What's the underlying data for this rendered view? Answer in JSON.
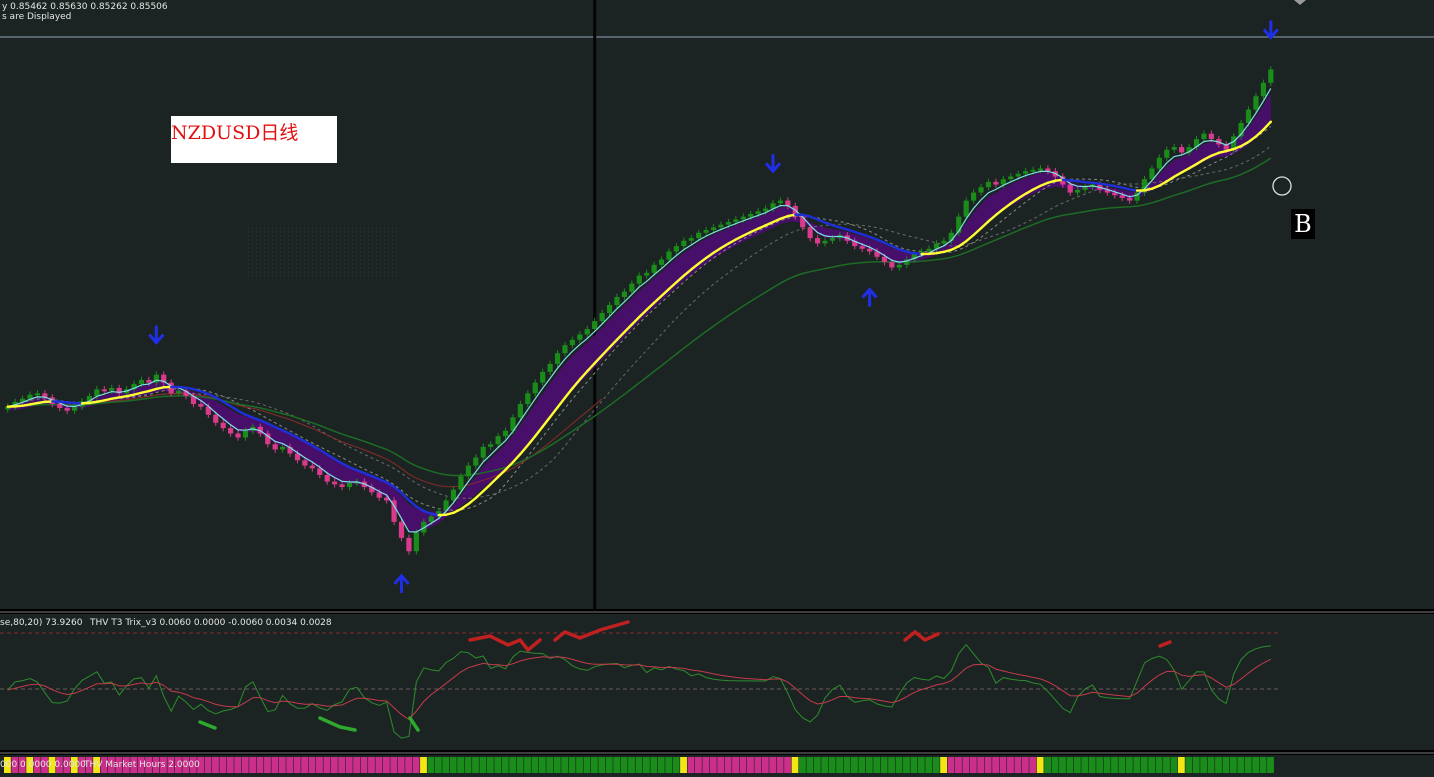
{
  "header": {
    "price_line": "y  0.85462 0.85630 0.85262 0.85506",
    "info_line": "s are Displayed"
  },
  "chart_label": "NZDUSD日线",
  "signal_label": "B",
  "subpanel1": {
    "label_left": "se,80,20) 73.9260",
    "label_right": "THV T3 Trix_v3   0.0060 0.0000 -0.0060 0.0034 0.0028"
  },
  "subpanel2": {
    "label_left": "000  0.0000 0.0000",
    "label_right": "THV Market Hours 2.0000"
  },
  "colors": {
    "background": "#1b2422",
    "bull": "#1a8c1a",
    "bear": "#d93a8c",
    "t3_fast": "#7fe0e6",
    "t3_up": "#ffff33",
    "t3_down": "#1f2fd8",
    "cloud": "#4a0f6e",
    "slow_ma": "#1e6b26",
    "trix_main": "#c63a4d",
    "trix_sig": "#2e8c2e",
    "arrow": "#1f2fe8",
    "hours_pink": "#cc2e8c",
    "hours_green": "#1a8c1a",
    "hours_yellow": "#f2e614"
  },
  "chart_data": {
    "type": "candlestick",
    "closes": [
      0.699,
      0.7008,
      0.702,
      0.7035,
      0.704,
      0.7025,
      0.7,
      0.6985,
      0.6975,
      0.699,
      0.701,
      0.703,
      0.7055,
      0.705,
      0.706,
      0.704,
      0.7055,
      0.7075,
      0.709,
      0.708,
      0.711,
      0.708,
      0.704,
      0.705,
      0.703,
      0.7,
      0.699,
      0.696,
      0.693,
      0.691,
      0.689,
      0.6875,
      0.69,
      0.6915,
      0.689,
      0.685,
      0.683,
      0.684,
      0.6815,
      0.679,
      0.677,
      0.676,
      0.6735,
      0.671,
      0.67,
      0.669,
      0.6705,
      0.671,
      0.669,
      0.667,
      0.665,
      0.664,
      0.656,
      0.65,
      0.645,
      0.652,
      0.656,
      0.658,
      0.66,
      0.664,
      0.668,
      0.673,
      0.677,
      0.68,
      0.684,
      0.685,
      0.688,
      0.69,
      0.695,
      0.7,
      0.704,
      0.708,
      0.712,
      0.715,
      0.719,
      0.722,
      0.724,
      0.726,
      0.728,
      0.731,
      0.734,
      0.737,
      0.74,
      0.742,
      0.745,
      0.748,
      0.749,
      0.752,
      0.754,
      0.757,
      0.759,
      0.761,
      0.762,
      0.764,
      0.765,
      0.766,
      0.767,
      0.768,
      0.769,
      0.77,
      0.771,
      0.772,
      0.773,
      0.775,
      0.776,
      0.774,
      0.77,
      0.766,
      0.762,
      0.76,
      0.761,
      0.762,
      0.763,
      0.761,
      0.759,
      0.758,
      0.757,
      0.755,
      0.753,
      0.751,
      0.752,
      0.754,
      0.756,
      0.757,
      0.758,
      0.76,
      0.761,
      0.764,
      0.77,
      0.776,
      0.779,
      0.781,
      0.783,
      0.782,
      0.784,
      0.785,
      0.786,
      0.787,
      0.7875,
      0.788,
      0.787,
      0.785,
      0.782,
      0.779,
      0.78,
      0.781,
      0.782,
      0.78,
      0.779,
      0.778,
      0.777,
      0.776,
      0.779,
      0.784,
      0.788,
      0.792,
      0.795,
      0.796,
      0.794,
      0.796,
      0.799,
      0.801,
      0.799,
      0.797,
      0.795,
      0.8,
      0.805,
      0.81,
      0.815,
      0.82,
      0.825
    ],
    "ohlc_last": {
      "open": 0.85462,
      "high": 0.8563,
      "low": 0.85262,
      "close": 0.85506
    },
    "arrows": [
      {
        "type": "down",
        "bar": 20
      },
      {
        "type": "up",
        "bar": 53
      },
      {
        "type": "down",
        "bar": 103
      },
      {
        "type": "up",
        "bar": 116
      },
      {
        "type": "down",
        "bar": 170
      }
    ],
    "vertical_marker_bar": 79,
    "market_hours_yellow_bars": [
      0,
      3,
      6,
      9,
      12,
      56,
      91,
      106,
      126,
      139,
      158,
      172
    ],
    "market_hours_green_ranges": [
      [
        56,
        91
      ],
      [
        106,
        126
      ],
      [
        139,
        158
      ],
      [
        159,
        172
      ]
    ]
  }
}
